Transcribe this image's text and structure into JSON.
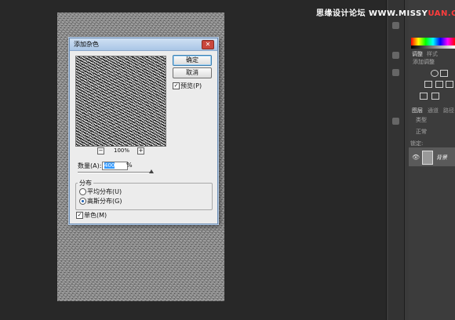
{
  "watermark": {
    "prefix": "思缘设计论坛 ",
    "mid": "WWW.MISSY",
    "suffix": "UAN.COM"
  },
  "dialog": {
    "title": "添加杂色",
    "close_glyph": "✕",
    "ok_label": "确定",
    "cancel_label": "取消",
    "preview_label": "预览(P)",
    "preview_checked": true,
    "zoom_minus": "−",
    "zoom_plus": "+",
    "zoom_value": "100%",
    "amount_label": "数量(A):",
    "amount_value": "400",
    "amount_unit": "%",
    "distribution_title": "分布",
    "uniform_label": "平均分布(U)",
    "gaussian_label": "高斯分布(G)",
    "selected_distribution": "gaussian",
    "mono_label": "单色(M)",
    "mono_checked": true
  },
  "right_panel": {
    "tab_adjust": "调整",
    "tab_style": "样式",
    "add_adjust": "添加调整",
    "tab_layers": "图层",
    "tab_channels": "通道",
    "tab_paths": "路径",
    "filter_type": "类型",
    "blend_mode": "正常",
    "lock_label": "锁定:",
    "layer_name": "背景",
    "eye_icon": "👁"
  },
  "colors": {
    "accent": "#3399ff",
    "watermark_red": "#ff3c3c"
  }
}
